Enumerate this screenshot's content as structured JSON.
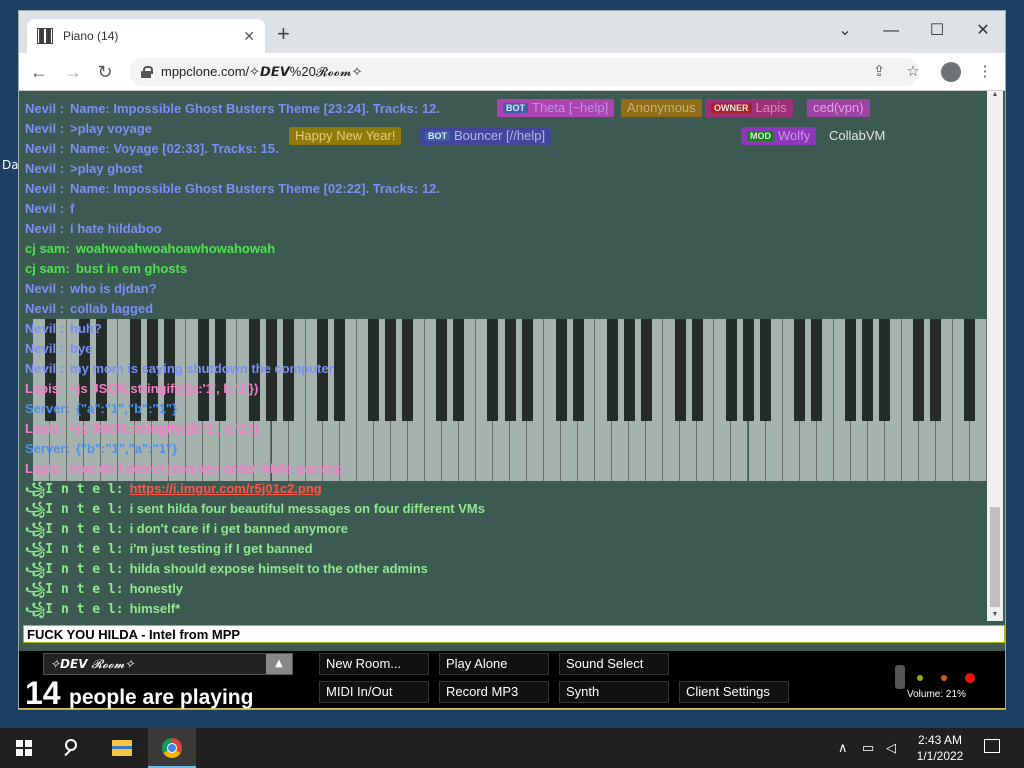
{
  "desktop": {
    "fragment": "Da"
  },
  "browser": {
    "tab_title": "Piano (14)",
    "tab_close": "✕",
    "new_tab": "+",
    "controls": {
      "dropdown": "⌄",
      "minimize": "—",
      "maximize": "☐",
      "close": "✕"
    },
    "nav": {
      "back": "←",
      "forward": "→",
      "reload": "↻"
    },
    "url": "mppclone.com/✧𝘿𝙀𝙑%20𝓡𝓸𝓸𝓶✧",
    "share_icon": "⇪",
    "star_icon": "☆",
    "menu_icon": "⋮"
  },
  "name_tags": [
    {
      "text": "Theta [~help]",
      "badge": "BOT",
      "badge_color": "#3a63b8",
      "color": "#d0a0ff",
      "bg": "#c040c0"
    },
    {
      "text": "Anonymous",
      "badge": "",
      "badge_color": "",
      "color": "#e0c080",
      "bg": "#a07010"
    },
    {
      "text": "Lapis",
      "badge": "OWNER",
      "badge_color": "#c01818",
      "color": "#f090c8",
      "bg": "#b02880"
    },
    {
      "text": "ced(vpn)",
      "badge": "",
      "badge_color": "",
      "color": "#ffb0ff",
      "bg": "#b040b0"
    },
    {
      "text": "Bouncer [//help]",
      "badge": "BOT",
      "badge_color": "#3a63b8",
      "color": "#c0c8ff",
      "bg": "#4444aa"
    },
    {
      "text": "Wolfy",
      "badge": "MOD",
      "badge_color": "#0a8a0a",
      "color": "#e8a0ff",
      "bg": "#9933cc"
    },
    {
      "text": "CollabVM",
      "badge": "",
      "badge_color": "",
      "color": "#ffffff",
      "bg": "transparent"
    },
    {
      "text": "Happy New Year!",
      "badge": "",
      "badge_color": "",
      "color": "#ffe080",
      "bg": "#a08000"
    }
  ],
  "chat": [
    {
      "name": "Nevil :",
      "text": "Name: Impossible Ghost Busters Theme [23:24]. Tracks: 12.",
      "color": "#7b8ff5"
    },
    {
      "name": "Nevil :",
      "text": ">play voyage",
      "color": "#7b8ff5"
    },
    {
      "name": "Nevil :",
      "text": "Name: Voyage [02:33]. Tracks: 15.",
      "color": "#7b8ff5"
    },
    {
      "name": "Nevil :",
      "text": ">play ghost",
      "color": "#7b8ff5"
    },
    {
      "name": "Nevil :",
      "text": "Name: Impossible Ghost Busters Theme [02:22]. Tracks: 12.",
      "color": "#7b8ff5"
    },
    {
      "name": "Nevil :",
      "text": "f",
      "color": "#7b8ff5"
    },
    {
      "name": "Nevil :",
      "text": "i hate hildaboo",
      "color": "#7b8ff5"
    },
    {
      "name": "cj sam:",
      "text": "woahwoahwoahoawhowahowah",
      "color": "#4ee24e"
    },
    {
      "name": "cj sam:",
      "text": "bust in em ghosts",
      "color": "#4ee24e"
    },
    {
      "name": "Nevil :",
      "text": "who is djdan?",
      "color": "#7b8ff5"
    },
    {
      "name": "Nevil :",
      "text": "collab lagged",
      "color": "#7b8ff5"
    },
    {
      "name": "Nevil :",
      "text": "huh?",
      "color": "#7b8ff5"
    },
    {
      "name": "Nevil :",
      "text": "bye",
      "color": "#7b8ff5"
    },
    {
      "name": "Nevil :",
      "text": "my mom is saying shutdown the computer",
      "color": "#7b8ff5"
    },
    {
      "name": "Lapis:",
      "text": "~js JSON.stringify({a:'1', b:'1'})",
      "color": "#f27fc7"
    },
    {
      "name": "Server:",
      "text": "{\"a\":\"1\",\"b\":\"1\"}",
      "color": "#4f8fe8"
    },
    {
      "name": "Lapis:",
      "text": "~js JSON.stringify({b:'1', a:'1'})",
      "color": "#f27fc7"
    },
    {
      "name": "Server:",
      "text": "{\"b\":\"1\",\"a\":\"1\"}",
      "color": "#4f8fe8"
    },
    {
      "name": "Lapis:",
      "text": "how do I detect json key order while parsing",
      "color": "#f27fc7"
    },
    {
      "name": "꧁I n t e l:",
      "text": "https://i.imgur.com/r5j01c2.png",
      "color": "#8fe88f",
      "link": true
    },
    {
      "name": "꧁I n t e l:",
      "text": "i sent hilda four beautiful messages on four different VMs",
      "color": "#8fe88f"
    },
    {
      "name": "꧁I n t e l:",
      "text": "i don't care if i get banned anymore",
      "color": "#8fe88f"
    },
    {
      "name": "꧁I n t e l:",
      "text": "i'm just testing if I get banned",
      "color": "#8fe88f"
    },
    {
      "name": "꧁I n t e l:",
      "text": "hilda should expose himselt to the other admins",
      "color": "#8fe88f"
    },
    {
      "name": "꧁I n t e l:",
      "text": "honestly",
      "color": "#8fe88f"
    },
    {
      "name": "꧁I n t e l:",
      "text": "himself*",
      "color": "#8fe88f"
    }
  ],
  "chat_input": {
    "value": "FUCK YOU HILDA - Intel from MPP"
  },
  "bottom": {
    "room_name": "✧𝘿𝙀𝙑 𝓡𝓸𝓸𝓶✧",
    "room_arrow": "▲",
    "people_count": "14",
    "people_label": "people are playing",
    "buttons": {
      "new_room": "New Room...",
      "play_alone": "Play Alone",
      "sound_select": "Sound Select",
      "midi": "MIDI In/Out",
      "record": "Record MP3",
      "synth": "Synth",
      "client_settings": "Client Settings"
    },
    "volume": "Volume: 21%",
    "volume_level": 0.21,
    "leds": [
      "#a0a020",
      "#d06010",
      "#ee1010"
    ]
  },
  "taskbar": {
    "time": "2:43 AM",
    "date": "1/1/2022",
    "tray_chevron": "∧",
    "network_icon": "▭",
    "volume_icon": "◁"
  }
}
